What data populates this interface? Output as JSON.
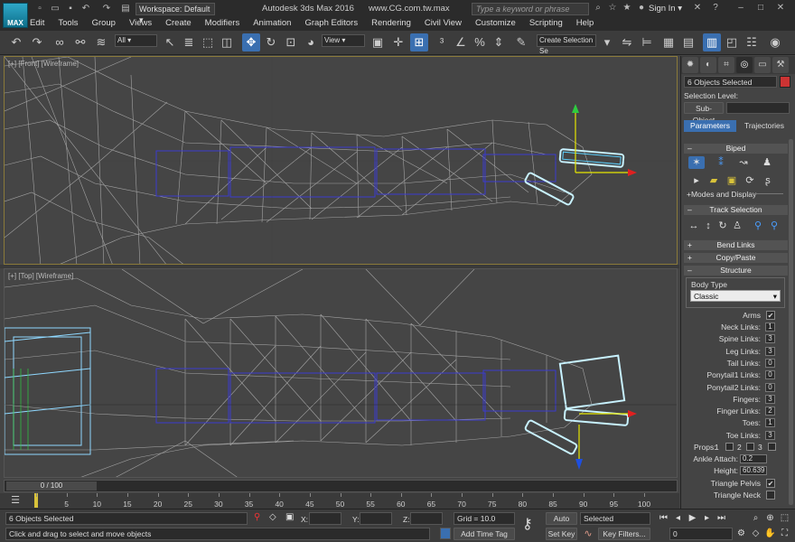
{
  "title_bar": {
    "app_logo": "MAX",
    "workspace": "Workspace: Default",
    "app_title": "Autodesk 3ds Max 2016",
    "site": "www.CG.com.tw.max",
    "search_placeholder": "Type a keyword or phrase",
    "sign_in": "Sign In"
  },
  "menu": [
    "Edit",
    "Tools",
    "Group",
    "Views",
    "Create",
    "Modifiers",
    "Animation",
    "Graph Editors",
    "Rendering",
    "Civil View",
    "Customize",
    "Scripting",
    "Help"
  ],
  "toolbar": {
    "selection_filter": "All",
    "reference_coord": "View",
    "named_selection_set": "Create Selection Se"
  },
  "viewports": [
    {
      "label": "[+] [Front] [Wireframe]"
    },
    {
      "label": "[+] [Top] [Wireframe]"
    }
  ],
  "timeline": {
    "slider": "0 / 100",
    "ticks": [
      "0",
      "5",
      "10",
      "15",
      "20",
      "25",
      "30",
      "35",
      "40",
      "45",
      "50",
      "55",
      "60",
      "65",
      "70",
      "75",
      "80",
      "85",
      "90",
      "95",
      "100"
    ]
  },
  "status": {
    "selection": "6 Objects Selected",
    "prompt": "Click and drag to select and move objects",
    "x_label": "X:",
    "y_label": "Y:",
    "z_label": "Z:",
    "grid": "Grid = 10.0",
    "add_time_tag": "Add Time Tag",
    "auto_key": "Auto Key",
    "set_key": "Set Key",
    "key_mode": "Selected",
    "key_filters": "Key Filters...",
    "frame": "0"
  },
  "command_panel": {
    "selection_info": "6 Objects Selected",
    "selection_color": "#cc3333",
    "selection_level": "Selection Level:",
    "sub_object": "Sub-Object",
    "tab_parameters": "Parameters",
    "tab_trajectories": "Trajectories",
    "biped_header": "Biped",
    "modes_and_display": "+Modes and Display",
    "track_selection_header": "Track Selection",
    "bend_links_header": "Bend Links",
    "copy_paste_header": "Copy/Paste",
    "structure_header": "Structure",
    "body_type_label": "Body Type",
    "body_type": "Classic",
    "arms_label": "Arms",
    "props_label": "Props:",
    "props_values": [
      "1",
      "2",
      "3"
    ],
    "links": [
      {
        "label": "Neck Links:",
        "value": "1"
      },
      {
        "label": "Spine Links:",
        "value": "3"
      },
      {
        "label": "Leg Links:",
        "value": "3"
      },
      {
        "label": "Tail Links:",
        "value": "0"
      },
      {
        "label": "Ponytail1 Links:",
        "value": "0"
      },
      {
        "label": "Ponytail2 Links:",
        "value": "0"
      },
      {
        "label": "Fingers:",
        "value": "3"
      },
      {
        "label": "Finger Links:",
        "value": "2"
      },
      {
        "label": "Toes:",
        "value": "1"
      },
      {
        "label": "Toe Links:",
        "value": "3"
      }
    ],
    "ankle_attach_label": "Ankle Attach:",
    "ankle_attach": "0.2",
    "height_label": "Height:",
    "height": "60.639",
    "triangle_pelvis": "Triangle Pelvis",
    "triangle_neck": "Triangle Neck"
  }
}
